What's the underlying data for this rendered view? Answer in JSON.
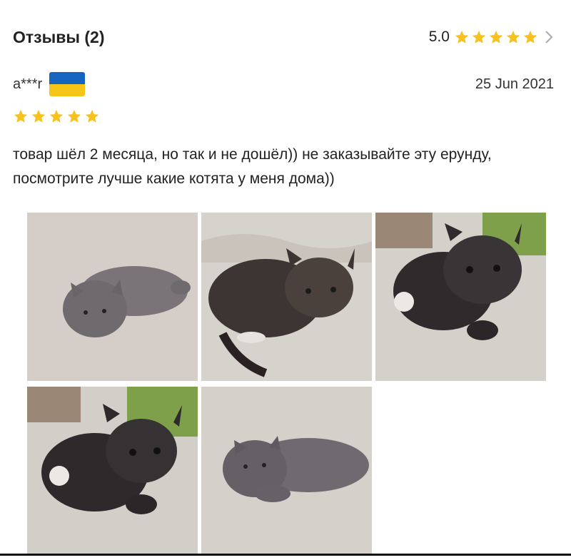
{
  "header": {
    "title": "Отзывы (2)",
    "rating": "5.0",
    "stars": 5,
    "star_color": "#f7c21d"
  },
  "review": {
    "author": "a***r",
    "country_flag": "ukraine-flag",
    "flag_colors": [
      "#1565c0",
      "#f5c518"
    ],
    "date": "25 Jun 2021",
    "stars": 5,
    "text": "товар шёл 2 месяца, но так и не дошёл)) не заказывайте эту ерунду, посмотрите лучше какие котята у меня дома))",
    "photos": [
      "grey-kitten-photo",
      "tabby-kitten-photo",
      "dark-tabby-kitten-photo",
      "dark-tabby-kitten-photo-2",
      "grey-kitten-lying-photo"
    ]
  }
}
